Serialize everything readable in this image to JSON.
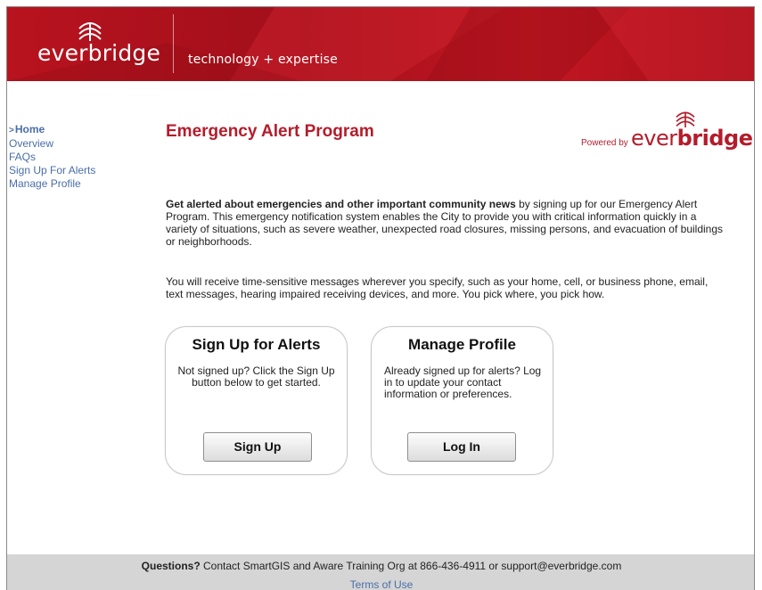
{
  "header": {
    "logo_text": "everbridge",
    "tagline": "technology + expertise"
  },
  "nav": {
    "items": [
      {
        "label": "Home",
        "active": true
      },
      {
        "label": "Overview"
      },
      {
        "label": "FAQs"
      },
      {
        "label": "Sign Up For Alerts"
      },
      {
        "label": "Manage Profile"
      }
    ]
  },
  "main": {
    "title": "Emergency Alert Program",
    "powered_by_label": "Powered by",
    "powered_by_brand_pre": "ever",
    "powered_by_brand_post": "bridge",
    "intro_bold": "Get alerted about emergencies and other important community news",
    "intro_rest": " by signing up for our Emergency Alert Program.  This emergency notification system enables the City to provide you with critical information quickly in a variety of situations, such as severe weather, unexpected road closures, missing persons, and evacuation of buildings or neighborhoods.",
    "intro2": "You will receive time-sensitive messages wherever you specify, such as your home, cell, or business phone, email, text messages, hearing impaired receiving devices, and more. You pick where, you pick how."
  },
  "cards": {
    "signup": {
      "title": "Sign Up for Alerts",
      "text": "Not signed up? Click the Sign Up button below to get started.",
      "button": "Sign Up"
    },
    "manage": {
      "title": "Manage Profile",
      "text": "Already signed up for alerts? Log in to update your contact information or preferences.",
      "button": "Log In"
    }
  },
  "footer": {
    "questions_bold": "Questions?",
    "questions_rest": " Contact SmartGIS and Aware Training Org at 866-436-4911 or support@everbridge.com",
    "terms": "Terms of Use"
  },
  "colors": {
    "brand_red": "#b41c2b",
    "link_blue": "#4a6ea8",
    "footer_gray": "#d5d5d5"
  },
  "icons": [
    "everbridge-logo-icon",
    "arrow-right-icon"
  ]
}
